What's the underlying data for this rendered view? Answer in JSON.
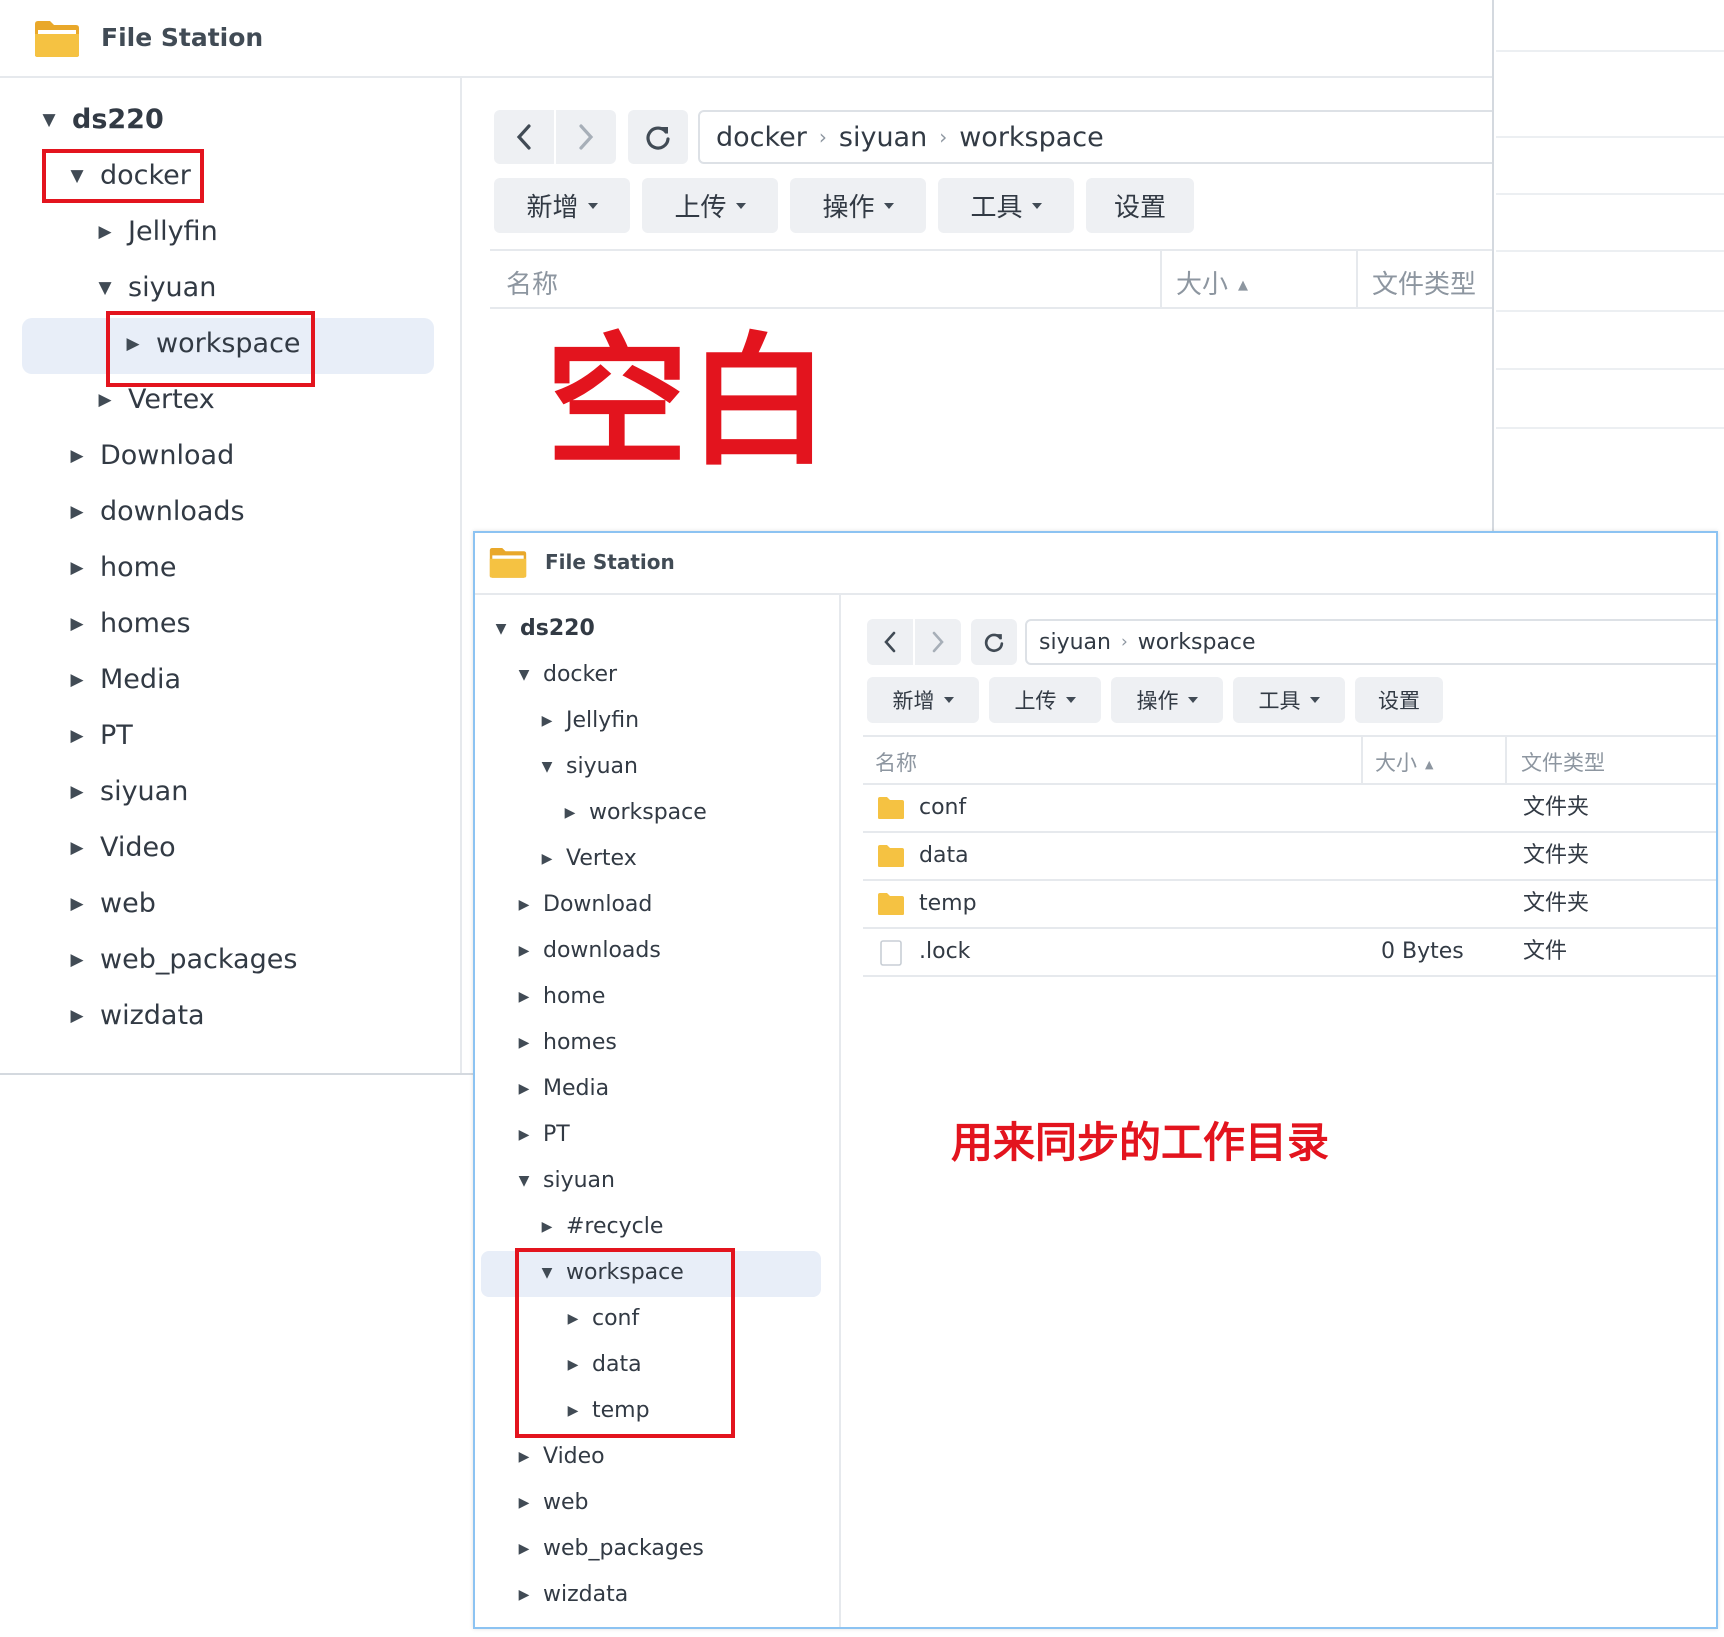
{
  "back_window": {
    "title": "File Station",
    "tree": [
      {
        "label": "ds220",
        "expanded": true
      },
      {
        "label": "docker",
        "expanded": true
      },
      {
        "label": "Jellyfin",
        "expanded": false
      },
      {
        "label": "siyuan",
        "expanded": true
      },
      {
        "label": "workspace",
        "expanded": false,
        "selected": true
      },
      {
        "label": "Vertex",
        "expanded": false
      },
      {
        "label": "Download",
        "expanded": false
      },
      {
        "label": "downloads",
        "expanded": false
      },
      {
        "label": "home",
        "expanded": false
      },
      {
        "label": "homes",
        "expanded": false
      },
      {
        "label": "Media",
        "expanded": false
      },
      {
        "label": "PT",
        "expanded": false
      },
      {
        "label": "siyuan",
        "expanded": false
      },
      {
        "label": "Video",
        "expanded": false
      },
      {
        "label": "web",
        "expanded": false
      },
      {
        "label": "web_packages",
        "expanded": false
      },
      {
        "label": "wizdata",
        "expanded": false
      }
    ],
    "breadcrumb": [
      "docker",
      "siyuan",
      "workspace"
    ],
    "toolbar": {
      "new": "新增",
      "upload": "上传",
      "action": "操作",
      "tools": "工具",
      "settings": "设置"
    },
    "columns": {
      "name": "名称",
      "size": "大小",
      "type": "文件类型"
    },
    "annotation": "空白"
  },
  "front_window": {
    "title": "File Station",
    "tree": [
      {
        "label": "ds220",
        "expanded": true
      },
      {
        "label": "docker",
        "expanded": true
      },
      {
        "label": "Jellyfin",
        "expanded": false
      },
      {
        "label": "siyuan",
        "expanded": true
      },
      {
        "label": "workspace",
        "expanded": false
      },
      {
        "label": "Vertex",
        "expanded": false
      },
      {
        "label": "Download",
        "expanded": false
      },
      {
        "label": "downloads",
        "expanded": false
      },
      {
        "label": "home",
        "expanded": false
      },
      {
        "label": "homes",
        "expanded": false
      },
      {
        "label": "Media",
        "expanded": false
      },
      {
        "label": "PT",
        "expanded": false
      },
      {
        "label": "siyuan",
        "expanded": true
      },
      {
        "label": "#recycle",
        "expanded": false
      },
      {
        "label": "workspace",
        "expanded": true,
        "selected": true
      },
      {
        "label": "conf",
        "expanded": false
      },
      {
        "label": "data",
        "expanded": false
      },
      {
        "label": "temp",
        "expanded": false
      },
      {
        "label": "Video",
        "expanded": false
      },
      {
        "label": "web",
        "expanded": false
      },
      {
        "label": "web_packages",
        "expanded": false
      },
      {
        "label": "wizdata",
        "expanded": false
      }
    ],
    "breadcrumb": [
      "siyuan",
      "workspace"
    ],
    "toolbar": {
      "new": "新增",
      "upload": "上传",
      "action": "操作",
      "tools": "工具",
      "settings": "设置"
    },
    "columns": {
      "name": "名称",
      "size": "大小",
      "type": "文件类型"
    },
    "files": [
      {
        "name": "conf",
        "size": "",
        "type": "文件夹",
        "icon": "folder-icon"
      },
      {
        "name": "data",
        "size": "",
        "type": "文件夹",
        "icon": "folder-icon"
      },
      {
        "name": "temp",
        "size": "",
        "type": "文件夹",
        "icon": "folder-icon"
      },
      {
        "name": ".lock",
        "size": "0 Bytes",
        "type": "文件",
        "icon": "file-icon"
      }
    ],
    "annotation": "用来同步的工作目录"
  },
  "colors": {
    "highlight": "#e3141e",
    "selection": "#e8eef8",
    "folder": "#f5c242",
    "window_border": "#8cc3f2"
  }
}
